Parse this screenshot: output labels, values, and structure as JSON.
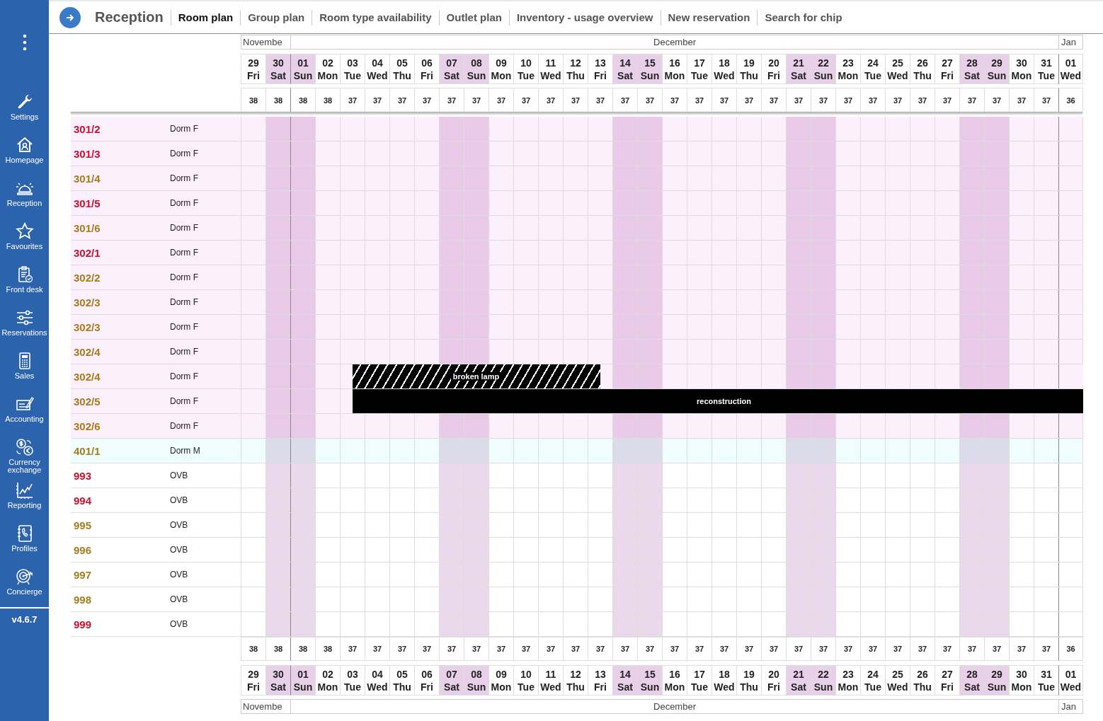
{
  "sidebar": {
    "items": [
      {
        "label": "Settings"
      },
      {
        "label": "Homepage"
      },
      {
        "label": "Reception"
      },
      {
        "label": "Favourites"
      },
      {
        "label": "Front desk"
      },
      {
        "label": "Reservations"
      },
      {
        "label": "Sales"
      },
      {
        "label": "Accounting"
      },
      {
        "label": "Currency exchange"
      },
      {
        "label": "Reporting"
      },
      {
        "label": "Profiles"
      },
      {
        "label": "Concierge"
      }
    ],
    "version": "v4.6.7"
  },
  "header": {
    "title": "Reception",
    "tabs": [
      {
        "label": "Room plan",
        "selected": true
      },
      {
        "label": "Group plan",
        "selected": false
      },
      {
        "label": "Room type availability",
        "selected": false
      },
      {
        "label": "Outlet plan",
        "selected": false
      },
      {
        "label": "Inventory - usage overview",
        "selected": false
      },
      {
        "label": "New reservation",
        "selected": false
      },
      {
        "label": "Search for chip",
        "selected": false
      }
    ]
  },
  "top_calendar": {
    "months": [
      {
        "name": "Novembe",
        "days": [
          {
            "date": "29",
            "weekday": "Fri",
            "weekend": false,
            "count": "38"
          },
          {
            "date": "30",
            "weekday": "Sat",
            "weekend": true,
            "count": "38"
          }
        ]
      },
      {
        "name": "December",
        "days": [
          {
            "date": "01",
            "weekday": "Sun",
            "weekend": true,
            "count": "38"
          },
          {
            "date": "02",
            "weekday": "Mon",
            "weekend": false,
            "count": "38"
          },
          {
            "date": "03",
            "weekday": "Tue",
            "weekend": false,
            "count": "37"
          },
          {
            "date": "04",
            "weekday": "Wed",
            "weekend": false,
            "count": "37"
          },
          {
            "date": "05",
            "weekday": "Thu",
            "weekend": false,
            "count": "37"
          },
          {
            "date": "06",
            "weekday": "Fri",
            "weekend": false,
            "count": "37"
          },
          {
            "date": "07",
            "weekday": "Sat",
            "weekend": true,
            "count": "37"
          },
          {
            "date": "08",
            "weekday": "Sun",
            "weekend": true,
            "count": "37"
          },
          {
            "date": "09",
            "weekday": "Mon",
            "weekend": false,
            "count": "37"
          },
          {
            "date": "10",
            "weekday": "Tue",
            "weekend": false,
            "count": "37"
          },
          {
            "date": "11",
            "weekday": "Wed",
            "weekend": false,
            "count": "37"
          },
          {
            "date": "12",
            "weekday": "Thu",
            "weekend": false,
            "count": "37"
          },
          {
            "date": "13",
            "weekday": "Fri",
            "weekend": false,
            "count": "37"
          },
          {
            "date": "14",
            "weekday": "Sat",
            "weekend": true,
            "count": "37"
          },
          {
            "date": "15",
            "weekday": "Sun",
            "weekend": true,
            "count": "37"
          },
          {
            "date": "16",
            "weekday": "Mon",
            "weekend": false,
            "count": "37"
          },
          {
            "date": "17",
            "weekday": "Tue",
            "weekend": false,
            "count": "37"
          },
          {
            "date": "18",
            "weekday": "Wed",
            "weekend": false,
            "count": "37"
          },
          {
            "date": "19",
            "weekday": "Thu",
            "weekend": false,
            "count": "37"
          },
          {
            "date": "20",
            "weekday": "Fri",
            "weekend": false,
            "count": "37"
          },
          {
            "date": "21",
            "weekday": "Sat",
            "weekend": true,
            "count": "37"
          },
          {
            "date": "22",
            "weekday": "Sun",
            "weekend": true,
            "count": "37"
          },
          {
            "date": "23",
            "weekday": "Mon",
            "weekend": false,
            "count": "37"
          },
          {
            "date": "24",
            "weekday": "Tue",
            "weekend": false,
            "count": "37"
          },
          {
            "date": "25",
            "weekday": "Wed",
            "weekend": false,
            "count": "37"
          },
          {
            "date": "26",
            "weekday": "Thu",
            "weekend": false,
            "count": "37"
          },
          {
            "date": "27",
            "weekday": "Fri",
            "weekend": false,
            "count": "37"
          },
          {
            "date": "28",
            "weekday": "Sat",
            "weekend": true,
            "count": "37"
          },
          {
            "date": "29",
            "weekday": "Sun",
            "weekend": true,
            "count": "37"
          },
          {
            "date": "30",
            "weekday": "Mon",
            "weekend": false,
            "count": "37"
          },
          {
            "date": "31",
            "weekday": "Tue",
            "weekend": false,
            "count": "37"
          }
        ]
      },
      {
        "name": "Jan",
        "days": [
          {
            "date": "01",
            "weekday": "Wed",
            "weekend": false,
            "count": "36"
          }
        ]
      }
    ]
  },
  "rooms": [
    {
      "number": "301/2",
      "type": "Dorm F",
      "color": "#c8102e",
      "kind": "female"
    },
    {
      "number": "301/3",
      "type": "Dorm F",
      "color": "#c8102e",
      "kind": "female"
    },
    {
      "number": "301/4",
      "type": "Dorm F",
      "color": "#a57c1b",
      "kind": "female"
    },
    {
      "number": "301/5",
      "type": "Dorm F",
      "color": "#c8102e",
      "kind": "female"
    },
    {
      "number": "301/6",
      "type": "Dorm F",
      "color": "#a57c1b",
      "kind": "female"
    },
    {
      "number": "302/1",
      "type": "Dorm F",
      "color": "#c8102e",
      "kind": "female"
    },
    {
      "number": "302/2",
      "type": "Dorm F",
      "color": "#a57c1b",
      "kind": "female"
    },
    {
      "number": "302/3",
      "type": "Dorm F",
      "color": "#a57c1b",
      "kind": "female"
    },
    {
      "number": "302/3",
      "type": "Dorm F",
      "color": "#a57c1b",
      "kind": "female"
    },
    {
      "number": "302/4",
      "type": "Dorm F",
      "color": "#a57c1b",
      "kind": "female"
    },
    {
      "number": "302/4",
      "type": "Dorm F",
      "color": "#a57c1b",
      "kind": "female",
      "blocks": [
        {
          "label": "broken lamp",
          "kind": "hatched"
        }
      ]
    },
    {
      "number": "302/5",
      "type": "Dorm F",
      "color": "#a57c1b",
      "kind": "female",
      "blocks": [
        {
          "label": "reconstruction",
          "kind": "solid"
        }
      ]
    },
    {
      "number": "302/6",
      "type": "Dorm F",
      "color": "#a57c1b",
      "kind": "female"
    },
    {
      "number": "401/1",
      "type": "Dorm M",
      "color": "#a57c1b",
      "kind": "male"
    },
    {
      "number": "993",
      "type": "OVB",
      "color": "#c8102e",
      "kind": "overbooking"
    },
    {
      "number": "994",
      "type": "OVB",
      "color": "#c8102e",
      "kind": "overbooking"
    },
    {
      "number": "995",
      "type": "OVB",
      "color": "#a57c1b",
      "kind": "overbooking"
    },
    {
      "number": "996",
      "type": "OVB",
      "color": "#a57c1b",
      "kind": "overbooking"
    },
    {
      "number": "997",
      "type": "OVB",
      "color": "#a57c1b",
      "kind": "overbooking"
    },
    {
      "number": "998",
      "type": "OVB",
      "color": "#a57c1b",
      "kind": "overbooking"
    },
    {
      "number": "999",
      "type": "OVB",
      "color": "#c8102e",
      "kind": "overbooking"
    }
  ],
  "bottom_calendar": {
    "months": [
      {
        "name": "Novembe",
        "days": [
          {
            "date": "29",
            "weekday": "Fri",
            "weekend": false,
            "count": "38"
          },
          {
            "date": "30",
            "weekday": "Sat",
            "weekend": true,
            "count": "38"
          }
        ]
      },
      {
        "name": "December",
        "days": [
          {
            "date": "01",
            "weekday": "Sun",
            "weekend": true,
            "count": "38"
          },
          {
            "date": "02",
            "weekday": "Mon",
            "weekend": false,
            "count": "38"
          },
          {
            "date": "03",
            "weekday": "Tue",
            "weekend": false,
            "count": "37"
          },
          {
            "date": "04",
            "weekday": "Wed",
            "weekend": false,
            "count": "37"
          },
          {
            "date": "05",
            "weekday": "Thu",
            "weekend": false,
            "count": "37"
          },
          {
            "date": "06",
            "weekday": "Fri",
            "weekend": false,
            "count": "37"
          },
          {
            "date": "07",
            "weekday": "Sat",
            "weekend": true,
            "count": "37"
          },
          {
            "date": "08",
            "weekday": "Sun",
            "weekend": true,
            "count": "37"
          },
          {
            "date": "09",
            "weekday": "Mon",
            "weekend": false,
            "count": "37"
          },
          {
            "date": "10",
            "weekday": "Tue",
            "weekend": false,
            "count": "37"
          },
          {
            "date": "11",
            "weekday": "Wed",
            "weekend": false,
            "count": "37"
          },
          {
            "date": "12",
            "weekday": "Thu",
            "weekend": false,
            "count": "37"
          },
          {
            "date": "13",
            "weekday": "Fri",
            "weekend": false,
            "count": "37"
          },
          {
            "date": "14",
            "weekday": "Sat",
            "weekend": true,
            "count": "37"
          },
          {
            "date": "15",
            "weekday": "Sun",
            "weekend": true,
            "count": "37"
          },
          {
            "date": "16",
            "weekday": "Mon",
            "weekend": false,
            "count": "37"
          },
          {
            "date": "17",
            "weekday": "Tue",
            "weekend": false,
            "count": "37"
          },
          {
            "date": "18",
            "weekday": "Wed",
            "weekend": false,
            "count": "37"
          },
          {
            "date": "19",
            "weekday": "Thu",
            "weekend": false,
            "count": "37"
          },
          {
            "date": "20",
            "weekday": "Fri",
            "weekend": false,
            "count": "37"
          },
          {
            "date": "21",
            "weekday": "Sat",
            "weekend": true,
            "count": "37"
          },
          {
            "date": "22",
            "weekday": "Sun",
            "weekend": true,
            "count": "37"
          },
          {
            "date": "23",
            "weekday": "Mon",
            "weekend": false,
            "count": "37"
          },
          {
            "date": "24",
            "weekday": "Tue",
            "weekend": false,
            "count": "37"
          },
          {
            "date": "25",
            "weekday": "Wed",
            "weekend": false,
            "count": "37"
          },
          {
            "date": "26",
            "weekday": "Thu",
            "weekend": false,
            "count": "37"
          },
          {
            "date": "27",
            "weekday": "Fri",
            "weekend": false,
            "count": "37"
          },
          {
            "date": "28",
            "weekday": "Sat",
            "weekend": true,
            "count": "37"
          },
          {
            "date": "29",
            "weekday": "Sun",
            "weekend": true,
            "count": "37"
          },
          {
            "date": "30",
            "weekday": "Mon",
            "weekend": false,
            "count": "37"
          },
          {
            "date": "31",
            "weekday": "Tue",
            "weekend": false,
            "count": "37"
          }
        ]
      },
      {
        "name": "Jan",
        "days": [
          {
            "date": "01",
            "weekday": "Wed",
            "weekend": false,
            "count": "36"
          }
        ]
      }
    ]
  }
}
